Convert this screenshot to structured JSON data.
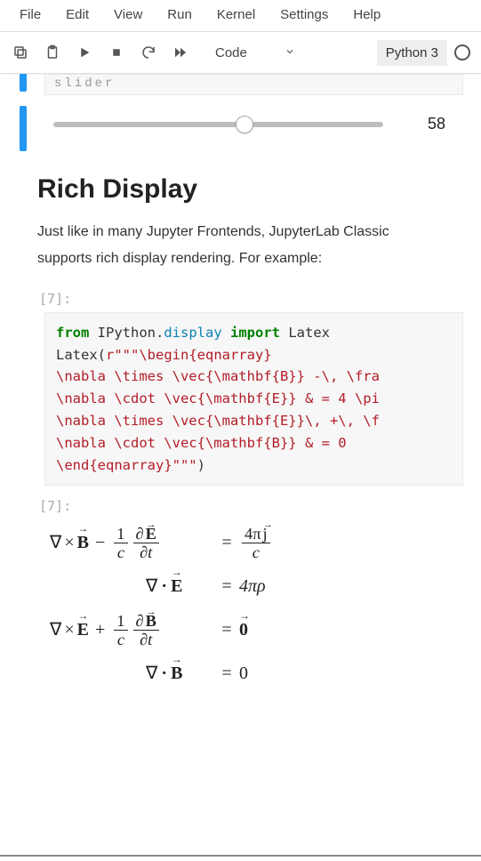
{
  "menubar": {
    "items": [
      "File",
      "Edit",
      "View",
      "Run",
      "Kernel",
      "Settings",
      "Help"
    ]
  },
  "toolbar": {
    "cell_type": "Code",
    "kernel_name": "Python 3"
  },
  "fragment_label": "slider",
  "slider": {
    "value": "58"
  },
  "heading": "Rich Display",
  "paragraph": "Just like in many Jupyter Frontends, JupyterLab Classic supports rich display rendering. For example:",
  "prompt_in": "[7]:",
  "prompt_out": "[7]:",
  "code": {
    "line1_kw1": "from",
    "line1_mod1": "IPython",
    "line1_dot": ".",
    "line1_mod2": "display",
    "line1_kw2": "import",
    "line1_plain": " Latex",
    "line2_plain": "Latex(",
    "line2_str_start": "r\"\"\"\\begin{eqnarray}",
    "line3": "\\nabla \\times \\vec{\\mathbf{B}} -\\, \\fra",
    "line4": "\\nabla \\cdot \\vec{\\mathbf{E}} & = 4 \\pi",
    "line5": "\\nabla \\times \\vec{\\mathbf{E}}\\, +\\, \\f",
    "line6": "\\nabla \\cdot \\vec{\\mathbf{B}} & = 0",
    "line7_str": "\\end{eqnarray}\"\"\"",
    "line7_close": ")"
  },
  "math": {
    "B": "B",
    "E": "E",
    "zero_vec": "0",
    "one": "1",
    "c": "c",
    "t": "t",
    "fourpi": "4π",
    "j": "j",
    "rho": "4πρ",
    "zero": "0"
  }
}
